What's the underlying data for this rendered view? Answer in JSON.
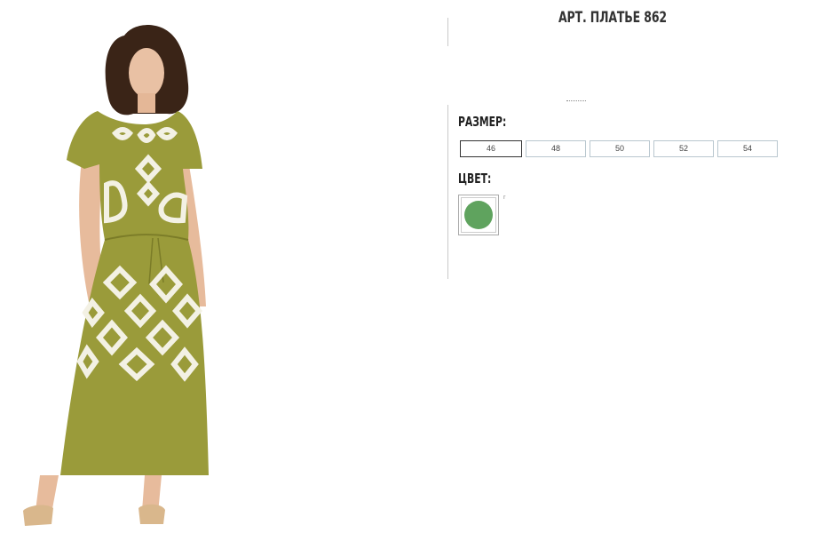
{
  "product": {
    "title": "АРТ. ПЛАТЬЕ 862"
  },
  "sizes": {
    "label": "РАЗМЕР:",
    "options": [
      "46",
      "48",
      "50",
      "52",
      "54"
    ],
    "selected": "46"
  },
  "colors": {
    "label": "ЦВЕТ:",
    "swatches": [
      {
        "color": "#5fa35e",
        "mark": "г"
      }
    ]
  },
  "photo": {
    "dress_color": "#9a9b3a",
    "print_color": "#f3f1e4"
  }
}
